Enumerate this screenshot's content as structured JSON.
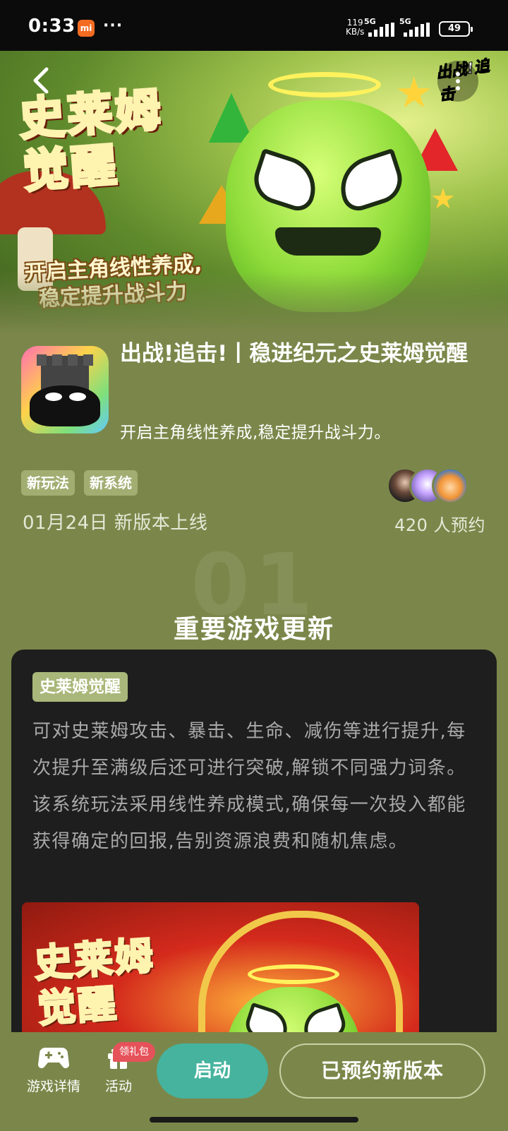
{
  "status_bar": {
    "time": "0:33",
    "notif_icon": "mi",
    "more": "···",
    "speed_value": "119",
    "speed_unit": "KB/s",
    "network1": "5G",
    "network2": "5G",
    "battery": "49"
  },
  "banner": {
    "title": "史莱姆觉醒",
    "subtitle_line1": "开启主角线性养成,",
    "subtitle_line2": "稳定提升战斗力",
    "logo_text": "出战!追击"
  },
  "game": {
    "title": "出战!追击!丨稳进纪元之史莱姆觉醒",
    "subtitle": "开启主角线性养成,稳定提升战斗力。",
    "tags": [
      "新玩法",
      "新系统"
    ],
    "release": "01月24日 新版本上线",
    "reservations": "420 人预约"
  },
  "section": {
    "number": "01",
    "title": "重要游戏更新",
    "card_tag": "史莱姆觉醒",
    "card_body": "可对史莱姆攻击、暴击、生命、减伤等进行提升,每次提升至满级后还可进行突破,解锁不同强力词条。该系统玩法采用线性养成模式,确保每一次投入都能获得确定的回报,告别资源浪费和随机焦虑。",
    "card_image_title": "史莱姆觉醒"
  },
  "bottom_bar": {
    "game_details": "游戏详情",
    "activity": "活动",
    "gift_badge": "领礼包",
    "launch": "启动",
    "reserved": "已预约新版本"
  },
  "colors": {
    "page_bg": "#7b874a",
    "card_bg": "#1e1e1e",
    "tag_bg": "#a2ad72",
    "launch_button": "#46b39e",
    "badge": "#e5525a"
  },
  "icons": [
    "back-arrow-icon",
    "more-vertical-icon",
    "gamepad-icon",
    "gift-icon"
  ]
}
